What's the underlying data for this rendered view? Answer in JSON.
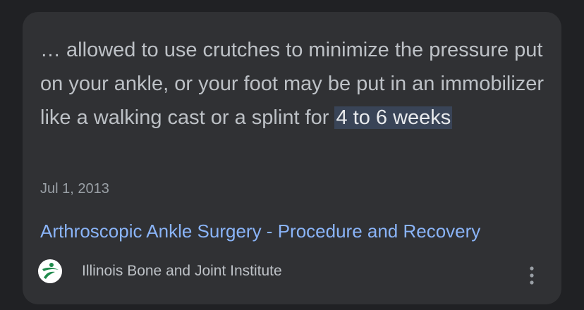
{
  "snippet": {
    "prefix": "… allowed to use crutches to minimize the pressure put on your ankle, or your foot may be put in an immobilizer like a walking cast or a splint for ",
    "highlight": "4 to 6 weeks"
  },
  "date": "Jul 1, 2013",
  "result": {
    "title": "Arthroscopic Ankle Surgery - Procedure and Recovery"
  },
  "source": {
    "name": "Illinois Bone and Joint Institute",
    "favicon_icon": "ibji-logo-icon",
    "more_icon": "more-vert-icon"
  },
  "colors": {
    "background": "#202124",
    "card": "#303134",
    "link": "#8ab4f8",
    "highlight_bg": "#394457",
    "logo_green": "#1f8a4c"
  }
}
